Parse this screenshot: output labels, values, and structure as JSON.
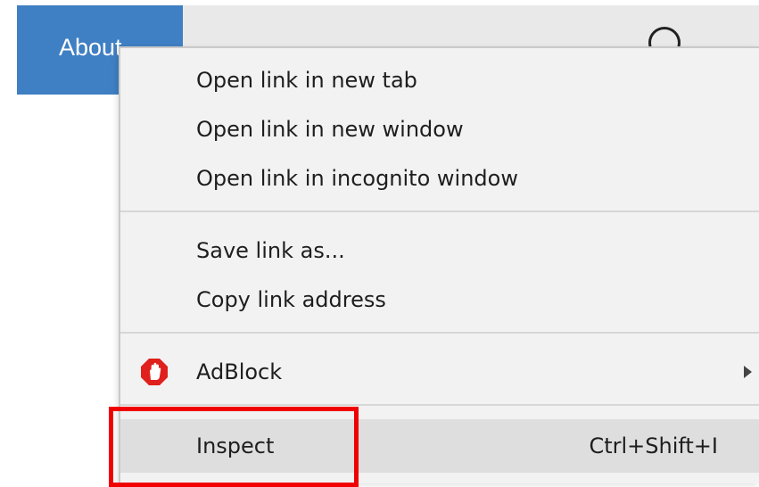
{
  "page": {
    "nav": {
      "about_label": "About",
      "about_color": "#3f7fc3"
    },
    "search_icon": "search-icon"
  },
  "context_menu": {
    "groups": [
      {
        "items": [
          {
            "label": "Open link in new tab"
          },
          {
            "label": "Open link in new window"
          },
          {
            "label": "Open link in incognito window"
          }
        ]
      },
      {
        "items": [
          {
            "label": "Save link as..."
          },
          {
            "label": "Copy link address"
          }
        ]
      },
      {
        "items": [
          {
            "label": "AdBlock",
            "icon": "adblock-icon",
            "has_submenu": true
          }
        ]
      },
      {
        "items": [
          {
            "label": "Inspect",
            "shortcut": "Ctrl+Shift+I",
            "highlighted": true
          }
        ]
      }
    ]
  },
  "annotation": {
    "highlight_color": "#f00000"
  }
}
